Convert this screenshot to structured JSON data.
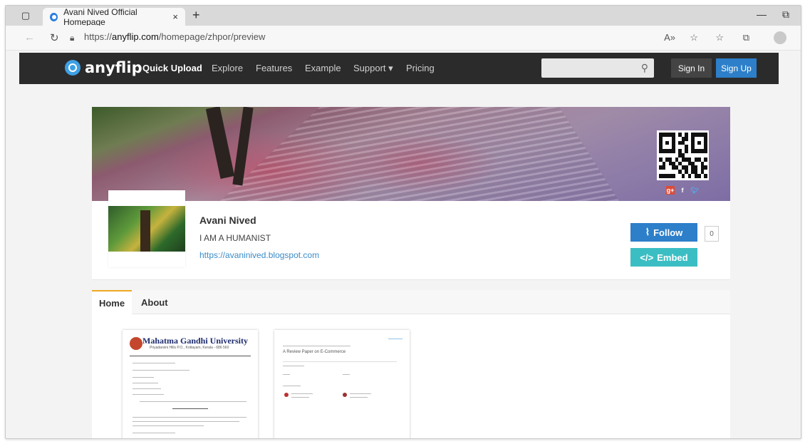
{
  "browser": {
    "tab_title": "Avani Nived Official Homepage",
    "tab_close": "×",
    "new_tab": "+",
    "url_prefix": "https://",
    "url_domain": "anyflip.com",
    "url_path": "/homepage/zhpor/preview"
  },
  "site": {
    "logo_text": "anyflip",
    "nav": [
      "Quick Upload",
      "Explore",
      "Features",
      "Example",
      "Support ▾",
      "Pricing"
    ],
    "sign_in": "Sign In",
    "sign_up": "Sign Up"
  },
  "profile": {
    "name": "Avani Nived",
    "tagline": "I AM A HUMANIST",
    "link": "https://avaninived.blogspot.com",
    "follow_label": "Follow",
    "follow_count": "0",
    "embed_label": "Embed"
  },
  "tabs": [
    "Home",
    "About"
  ],
  "books": [
    {
      "title": "Mahatma Gandhi University",
      "subtitle": "Priyadarsini Hills P.O., Kottayam, Kerala - 686 560"
    },
    {
      "title": "A Review Paper on E-Commerce"
    }
  ],
  "colors": {
    "nav_bg": "#2b2b2b",
    "primary": "#2d7fc9",
    "embed": "#3bbec3",
    "tab_accent": "#f0a824"
  }
}
